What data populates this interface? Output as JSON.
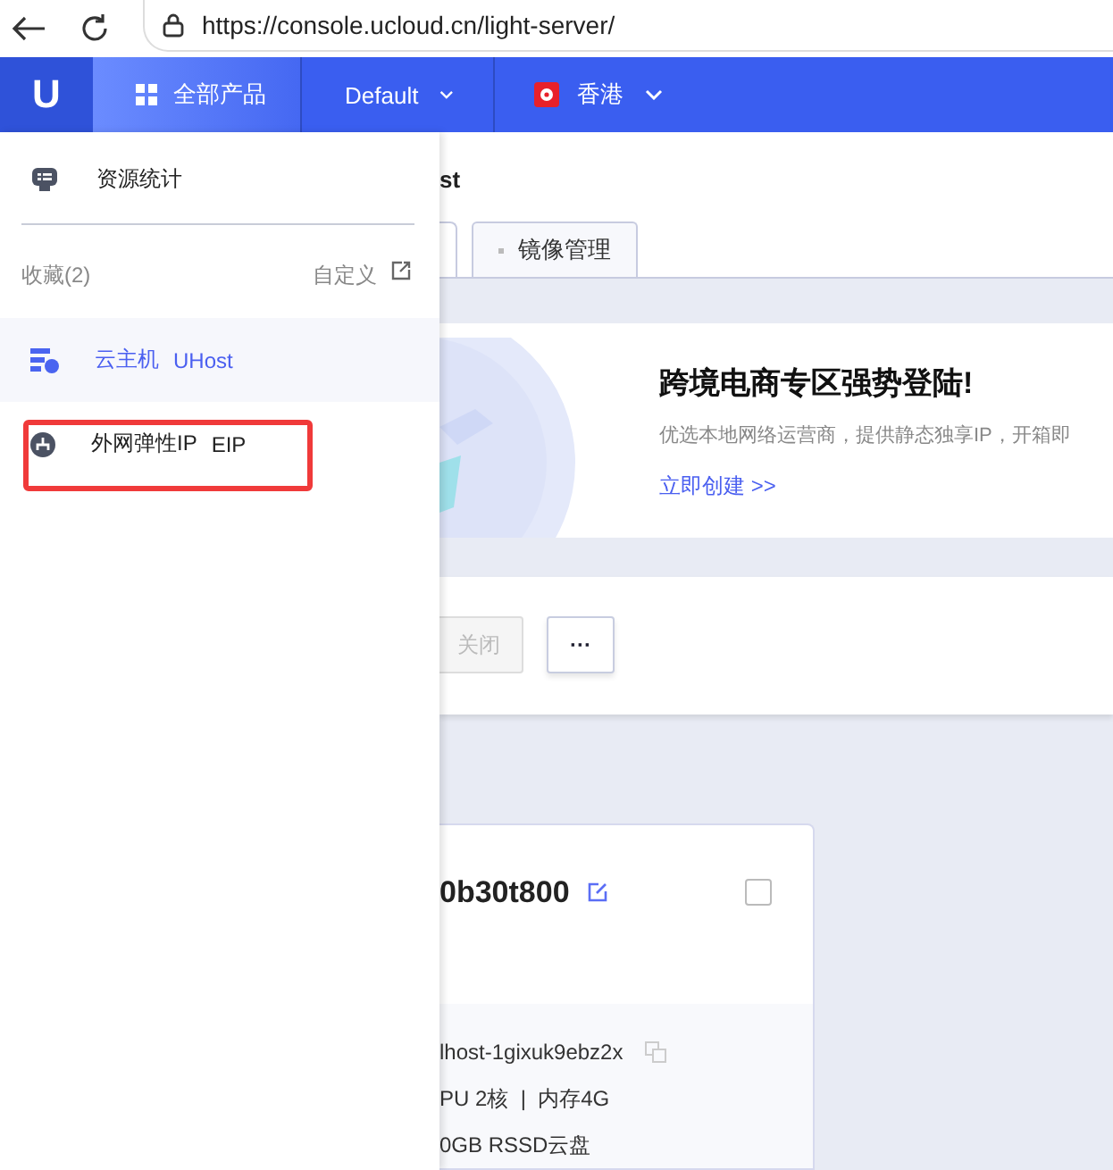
{
  "browser": {
    "url": "https://console.ucloud.cn/light-server/"
  },
  "navbar": {
    "logo": "U",
    "products": "全部产品",
    "project": "Default",
    "region": "香港"
  },
  "sidebar": {
    "overview": "资源统计",
    "favorites_label": "收藏(2)",
    "customize": "自定义",
    "favorites": [
      {
        "name": "云主机",
        "code": "UHost",
        "selected": true,
        "highlighted": false
      },
      {
        "name": "外网弹性IP",
        "code": "EIP",
        "selected": false,
        "highlighted": true
      }
    ]
  },
  "page": {
    "title": "st",
    "tabs": [
      {
        "label": "镜像管理",
        "selected": false
      }
    ]
  },
  "banner": {
    "title": "跨境电商专区强势登陆!",
    "description": "优选本地网络运营商，提供静态独享IP，开箱即",
    "link": "立即创建 >>"
  },
  "toolbar": {
    "buttons": [
      {
        "label": "关闭",
        "disabled": true
      },
      {
        "label": "···",
        "disabled": false
      }
    ]
  },
  "card": {
    "name": "0b30t800",
    "checked": false,
    "id": "lhost-1gixuk9ebz2x",
    "spec": "PU 2核  |  内存4G",
    "disk": "0GB RSSD云盘"
  }
}
